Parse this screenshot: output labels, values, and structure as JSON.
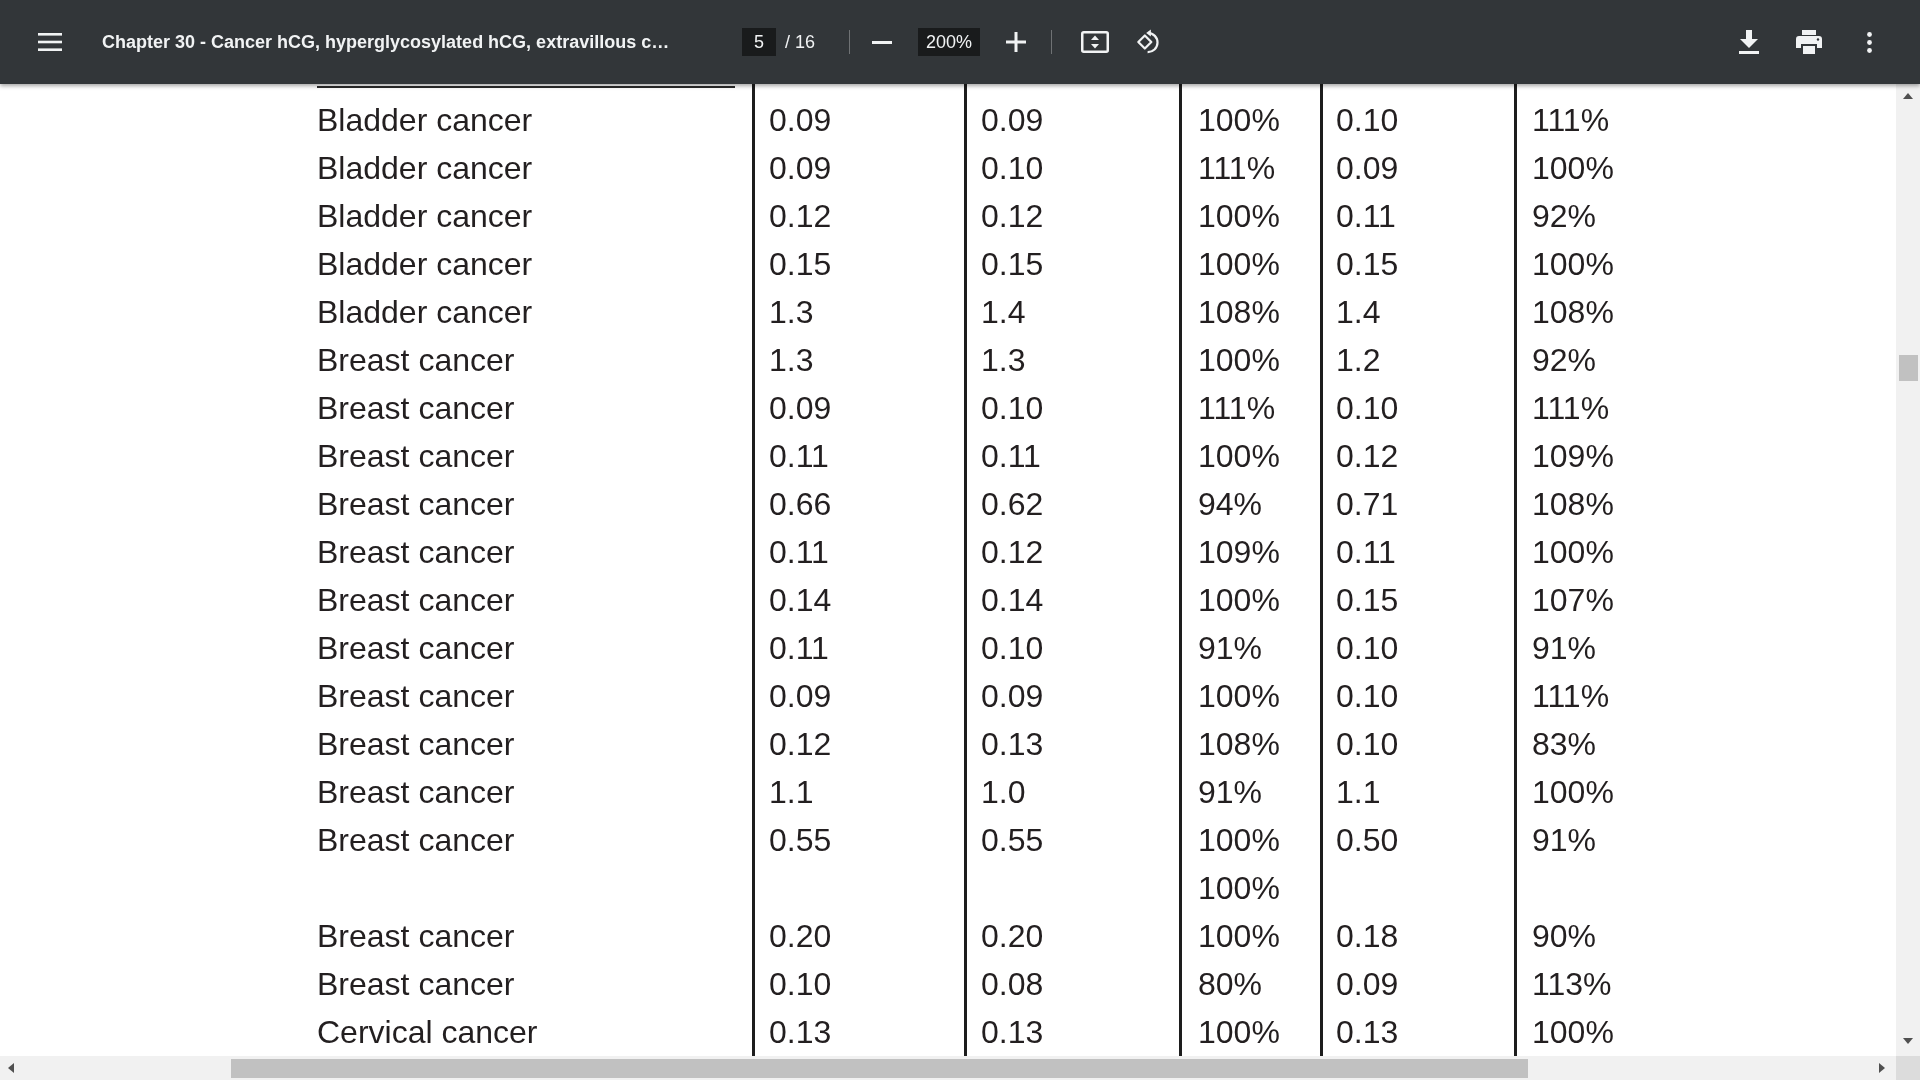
{
  "toolbar": {
    "title": "Chapter 30 - Cancer hCG, hyperglycosylated hCG, extravillous c…",
    "page_number": "5",
    "page_total": "/ 16",
    "zoom": "200%"
  },
  "table": {
    "rows": [
      {
        "column_1": "Bladder cancer",
        "column_2": "0.09",
        "column_3": "0.09",
        "column_4": "100%",
        "column_5": "0.10",
        "column_6": "111%"
      },
      {
        "column_1": "Bladder cancer",
        "column_2": "0.09",
        "column_3": "0.10",
        "column_4": "111%",
        "column_5": "0.09",
        "column_6": "100%"
      },
      {
        "column_1": "Bladder cancer",
        "column_2": "0.12",
        "column_3": "0.12",
        "column_4": "100%",
        "column_5": "0.11",
        "column_6": "92%"
      },
      {
        "column_1": "Bladder cancer",
        "column_2": "0.15",
        "column_3": "0.15",
        "column_4": "100%",
        "column_5": "0.15",
        "column_6": "100%"
      },
      {
        "column_1": "Bladder cancer",
        "column_2": "1.3",
        "column_3": "1.4",
        "column_4": "108%",
        "column_5": "1.4",
        "column_6": "108%"
      },
      {
        "column_1": "Breast cancer",
        "column_2": "1.3",
        "column_3": "1.3",
        "column_4": "100%",
        "column_5": "1.2",
        "column_6": "92%"
      },
      {
        "column_1": "Breast cancer",
        "column_2": "0.09",
        "column_3": "0.10",
        "column_4": "111%",
        "column_5": "0.10",
        "column_6": "111%"
      },
      {
        "column_1": "Breast cancer",
        "column_2": "0.11",
        "column_3": "0.11",
        "column_4": "100%",
        "column_5": "0.12",
        "column_6": "109%"
      },
      {
        "column_1": "Breast cancer",
        "column_2": "0.66",
        "column_3": "0.62",
        "column_4": "94%",
        "column_5": "0.71",
        "column_6": "108%"
      },
      {
        "column_1": "Breast cancer",
        "column_2": "0.11",
        "column_3": "0.12",
        "column_4": "109%",
        "column_5": "0.11",
        "column_6": "100%"
      },
      {
        "column_1": "Breast cancer",
        "column_2": "0.14",
        "column_3": "0.14",
        "column_4": "100%",
        "column_5": "0.15",
        "column_6": "107%"
      },
      {
        "column_1": "Breast cancer",
        "column_2": "0.11",
        "column_3": "0.10",
        "column_4": "91%",
        "column_5": "0.10",
        "column_6": "91%"
      },
      {
        "column_1": "Breast cancer",
        "column_2": "0.09",
        "column_3": "0.09",
        "column_4": "100%",
        "column_5": "0.10",
        "column_6": "111%"
      },
      {
        "column_1": "Breast cancer",
        "column_2": "0.12",
        "column_3": "0.13",
        "column_4": "108%",
        "column_5": "0.10",
        "column_6": "83%"
      },
      {
        "column_1": "Breast cancer",
        "column_2": "1.1",
        "column_3": "1.0",
        "column_4": "91%",
        "column_5": "1.1",
        "column_6": "100%"
      },
      {
        "column_1": "Breast cancer",
        "column_2": "0.55",
        "column_3": "0.55",
        "column_4": "100%",
        "column_5": "0.50",
        "column_6": "91%"
      },
      {
        "column_4": "100%"
      },
      {
        "column_1": "Breast cancer",
        "column_2": "0.20",
        "column_3": "0.20",
        "column_4": "100%",
        "column_5": "0.18",
        "column_6": "90%"
      },
      {
        "column_1": "Breast cancer",
        "column_2": "0.10",
        "column_3": "0.08",
        "column_4": "80%",
        "column_5": "0.09",
        "column_6": "113%"
      },
      {
        "column_1": "Cervical cancer",
        "column_2": "0.13",
        "column_3": "0.13",
        "column_4": "100%",
        "column_5": "0.13",
        "column_6": "100%"
      }
    ]
  }
}
